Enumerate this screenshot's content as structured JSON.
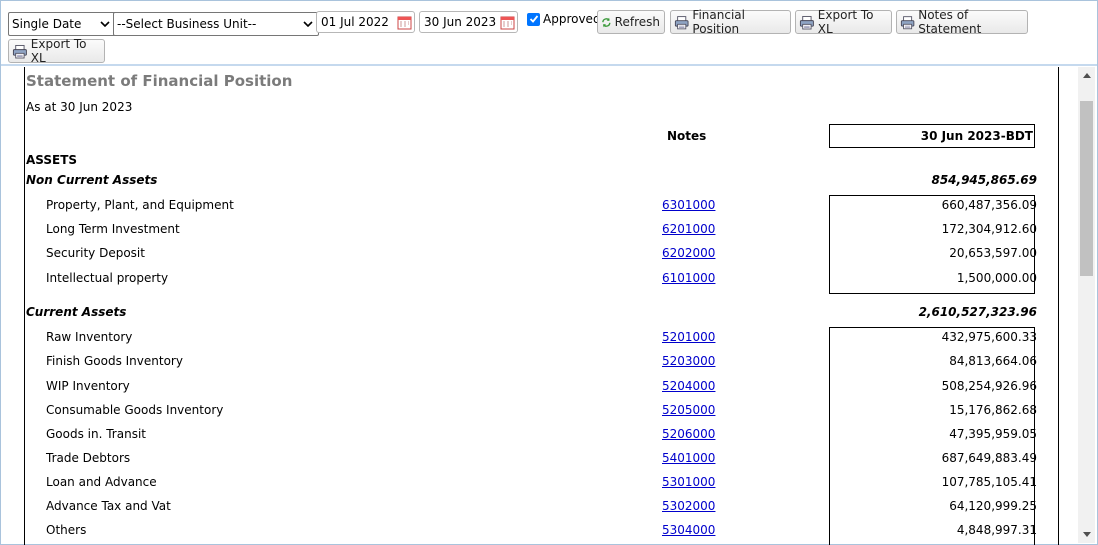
{
  "toolbar": {
    "report_mode": "Single Date",
    "business_unit": "--Select Business Unit--",
    "date_from": "01 Jul 2022",
    "date_to": "30 Jun 2023",
    "approved_label": "Approved",
    "approved_checked": true,
    "refresh_label": "Refresh",
    "financial_position_label": "Financial Position",
    "export_xl_label": "Export To XL",
    "notes_of_statement_label": "Notes of Statement",
    "export_xl2_label": "Export To XL"
  },
  "report": {
    "title": "Statement of Financial Position",
    "as_at": "As at 30 Jun 2023",
    "notes_header": "Notes",
    "period_header": "30 Jun 2023-BDT",
    "section_assets": "ASSETS",
    "non_current": {
      "label": "Non Current Assets",
      "total": "854,945,865.69",
      "rows": [
        {
          "label": "Property, Plant, and Equipment",
          "note": "6301000",
          "amount": "660,487,356.09"
        },
        {
          "label": "Long Term Investment",
          "note": "6201000",
          "amount": "172,304,912.60"
        },
        {
          "label": "Security Deposit",
          "note": "6202000",
          "amount": "20,653,597.00"
        },
        {
          "label": "Intellectual property",
          "note": "6101000",
          "amount": "1,500,000.00"
        }
      ]
    },
    "current": {
      "label": "Current Assets",
      "total": "2,610,527,323.96",
      "rows": [
        {
          "label": "Raw Inventory",
          "note": "5201000",
          "amount": "432,975,600.33"
        },
        {
          "label": "Finish Goods Inventory",
          "note": "5203000",
          "amount": "84,813,664.06"
        },
        {
          "label": "WIP Inventory",
          "note": "5204000",
          "amount": "508,254,926.96"
        },
        {
          "label": "Consumable Goods Inventory",
          "note": "5205000",
          "amount": "15,176,862.68"
        },
        {
          "label": "Goods in. Transit",
          "note": "5206000",
          "amount": "47,395,959.05"
        },
        {
          "label": "Trade Debtors",
          "note": "5401000",
          "amount": "687,649,883.49"
        },
        {
          "label": "Loan and Advance",
          "note": "5301000",
          "amount": "107,785,105.41"
        },
        {
          "label": "Advance Tax and Vat",
          "note": "5302000",
          "amount": "64,120,999.25"
        },
        {
          "label": "Others",
          "note": "5304000",
          "amount": "4,848,997.31"
        }
      ]
    }
  },
  "colors": {
    "link": "#0000cc",
    "title_gray": "#7b7b7b",
    "checkbox": "#0075ff"
  }
}
